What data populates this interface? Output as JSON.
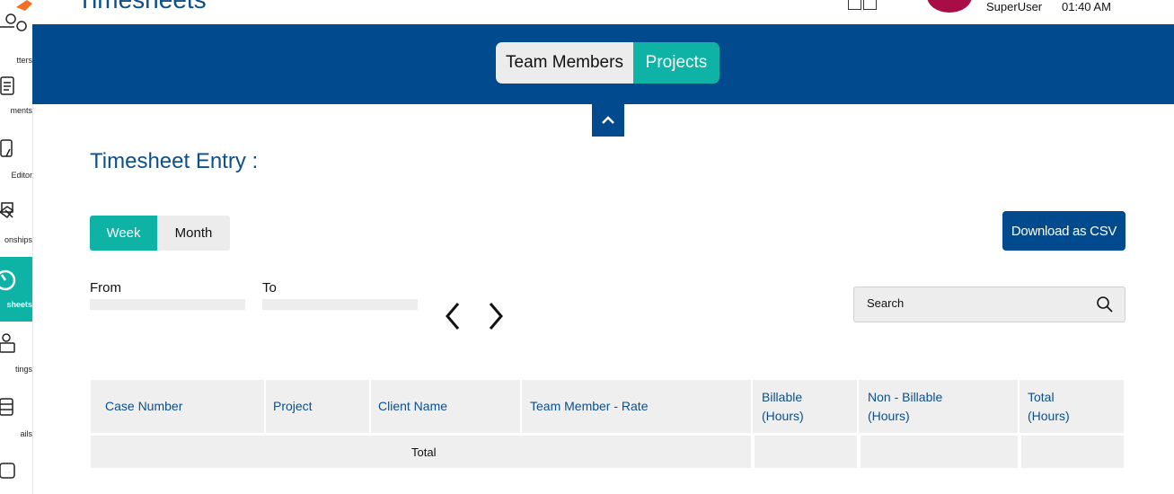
{
  "app": {
    "page_title": "Timesheets",
    "user": "SuperUser",
    "time": "01:40 AM"
  },
  "sidebar": {
    "items": [
      {
        "label": "tters",
        "icon": "filter-icon"
      },
      {
        "label": "ments",
        "icon": "document-icon"
      },
      {
        "label": "Editor",
        "icon": "doc-edit-icon"
      },
      {
        "label": "onships",
        "icon": "handshake-icon"
      },
      {
        "label": "sheets",
        "icon": "stopwatch-icon",
        "active": true
      },
      {
        "label": "tings",
        "icon": "meeting-icon"
      },
      {
        "label": "ails",
        "icon": "mail-icon"
      },
      {
        "label": "",
        "icon": "chat-icon"
      }
    ]
  },
  "tabs": {
    "team_members": "Team Members",
    "projects": "Projects"
  },
  "section": {
    "title": "Timesheet Entry :"
  },
  "period": {
    "week": "Week",
    "month": "Month",
    "selected": "Week"
  },
  "download_label": "Download as CSV",
  "range": {
    "from_label": "From",
    "to_label": "To",
    "from_value": "",
    "to_value": ""
  },
  "search": {
    "placeholder": "Search"
  },
  "table": {
    "headers": [
      [
        "Case Number"
      ],
      [
        "Project"
      ],
      [
        "Client Name"
      ],
      [
        "Team Member - Rate"
      ],
      [
        "Billable",
        "(Hours)"
      ],
      [
        "Non - Billable",
        "(Hours)"
      ],
      [
        "Total",
        "(Hours)"
      ]
    ],
    "total_label": "Total"
  },
  "colors": {
    "primary_blue": "#004a8d",
    "teal": "#0fb3a5",
    "title_blue": "#0b4f8c",
    "avatar": "#a80d46"
  }
}
